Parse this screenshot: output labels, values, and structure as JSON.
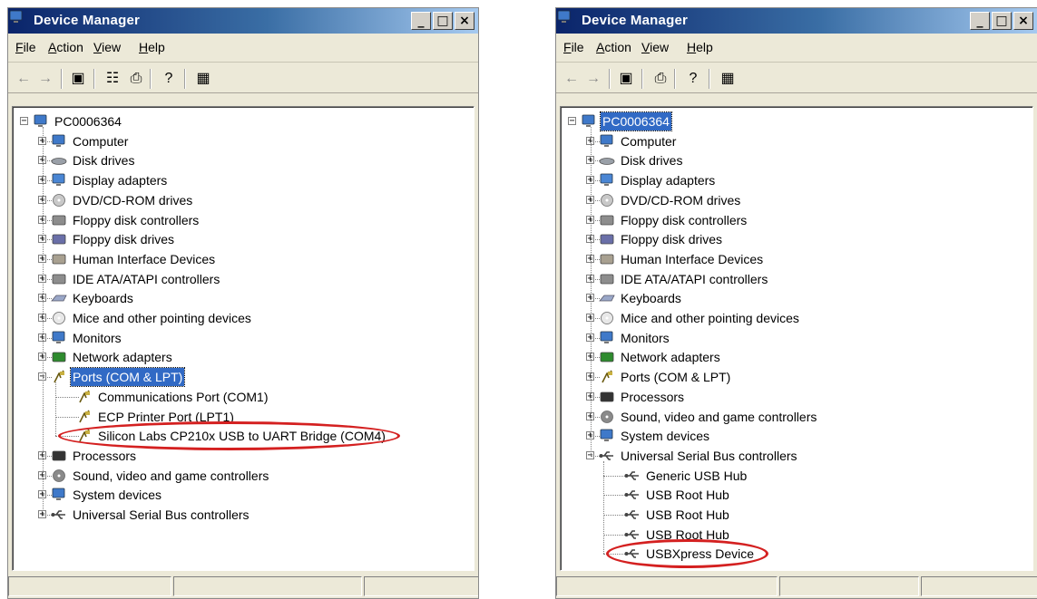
{
  "windows": [
    {
      "title": "Device Manager",
      "menu": [
        "File",
        "Action",
        "View",
        "Help"
      ],
      "root": "PC0006364",
      "categories": [
        {
          "label": "Computer",
          "icon": "computer-icon"
        },
        {
          "label": "Disk drives",
          "icon": "disk-drive-icon"
        },
        {
          "label": "Display adapters",
          "icon": "display-adapter-icon"
        },
        {
          "label": "DVD/CD-ROM drives",
          "icon": "dvd-drive-icon"
        },
        {
          "label": "Floppy disk controllers",
          "icon": "controller-icon"
        },
        {
          "label": "Floppy disk drives",
          "icon": "floppy-drive-icon"
        },
        {
          "label": "Human Interface Devices",
          "icon": "hid-icon"
        },
        {
          "label": "IDE ATA/ATAPI controllers",
          "icon": "controller-icon"
        },
        {
          "label": "Keyboards",
          "icon": "keyboard-icon"
        },
        {
          "label": "Mice and other pointing devices",
          "icon": "mouse-icon"
        },
        {
          "label": "Monitors",
          "icon": "monitor-icon"
        },
        {
          "label": "Network adapters",
          "icon": "network-adapter-icon"
        },
        {
          "label": "Ports (COM & LPT)",
          "icon": "port-icon",
          "expanded": true,
          "selected": true,
          "children": [
            {
              "label": "Communications Port (COM1)",
              "icon": "port-icon"
            },
            {
              "label": "ECP Printer Port (LPT1)",
              "icon": "port-icon"
            },
            {
              "label": "Silicon Labs CP210x USB to UART Bridge (COM4)",
              "icon": "port-icon",
              "circled": true
            }
          ]
        },
        {
          "label": "Processors",
          "icon": "processor-icon"
        },
        {
          "label": "Sound, video and game controllers",
          "icon": "sound-icon"
        },
        {
          "label": "System devices",
          "icon": "system-device-icon"
        },
        {
          "label": "Universal Serial Bus controllers",
          "icon": "usb-icon"
        }
      ]
    },
    {
      "title": "Device Manager",
      "menu": [
        "File",
        "Action",
        "View",
        "Help"
      ],
      "root": "PC0006364",
      "root_selected": true,
      "categories": [
        {
          "label": "Computer",
          "icon": "computer-icon"
        },
        {
          "label": "Disk drives",
          "icon": "disk-drive-icon"
        },
        {
          "label": "Display adapters",
          "icon": "display-adapter-icon"
        },
        {
          "label": "DVD/CD-ROM drives",
          "icon": "dvd-drive-icon"
        },
        {
          "label": "Floppy disk controllers",
          "icon": "controller-icon"
        },
        {
          "label": "Floppy disk drives",
          "icon": "floppy-drive-icon"
        },
        {
          "label": "Human Interface Devices",
          "icon": "hid-icon"
        },
        {
          "label": "IDE ATA/ATAPI controllers",
          "icon": "controller-icon"
        },
        {
          "label": "Keyboards",
          "icon": "keyboard-icon"
        },
        {
          "label": "Mice and other pointing devices",
          "icon": "mouse-icon"
        },
        {
          "label": "Monitors",
          "icon": "monitor-icon"
        },
        {
          "label": "Network adapters",
          "icon": "network-adapter-icon"
        },
        {
          "label": "Ports (COM & LPT)",
          "icon": "port-icon"
        },
        {
          "label": "Processors",
          "icon": "processor-icon"
        },
        {
          "label": "Sound, video and game controllers",
          "icon": "sound-icon"
        },
        {
          "label": "System devices",
          "icon": "system-device-icon"
        },
        {
          "label": "Universal Serial Bus controllers",
          "icon": "usb-icon",
          "expanded": true,
          "children": [
            {
              "label": "Generic USB Hub",
              "icon": "usb-icon"
            },
            {
              "label": "USB Root Hub",
              "icon": "usb-icon"
            },
            {
              "label": "USB Root Hub",
              "icon": "usb-icon"
            },
            {
              "label": "USB Root Hub",
              "icon": "usb-icon"
            },
            {
              "label": "USBXpress Device",
              "icon": "usb-icon",
              "circled": true
            }
          ]
        }
      ]
    }
  ],
  "colors": {
    "highlight_ring": "#d42020",
    "selection": "#316ac5",
    "title_bar": "#0a246a"
  }
}
